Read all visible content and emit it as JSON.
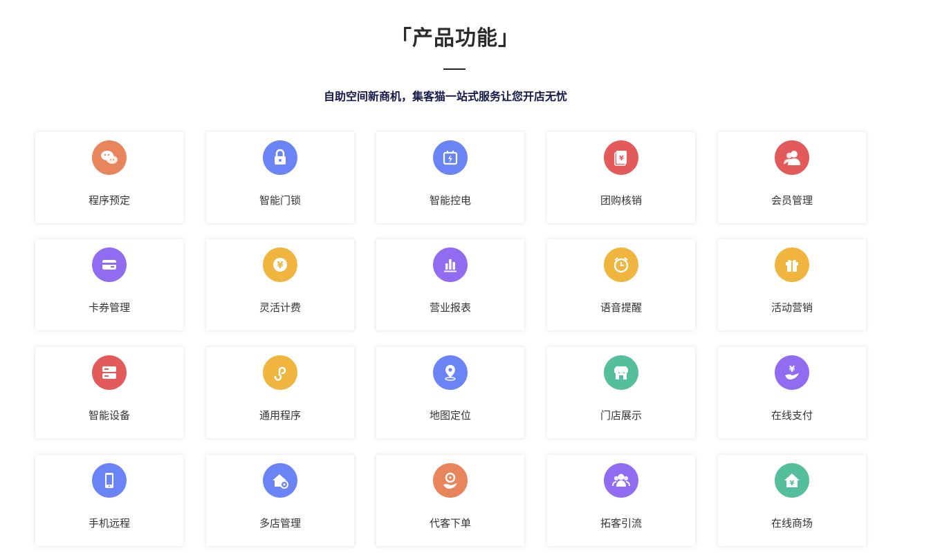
{
  "section": {
    "title": "「产品功能」",
    "subtitle": "自助空间新商机，集客猫一站式服务让您开店无忧"
  },
  "features": [
    {
      "label": "程序预定",
      "icon": "chat-bubbles-icon",
      "color": "#e8855d"
    },
    {
      "label": "智能门锁",
      "icon": "lock-icon",
      "color": "#6b84f5"
    },
    {
      "label": "智能控电",
      "icon": "power-socket-icon",
      "color": "#6b84f5"
    },
    {
      "label": "团购核销",
      "icon": "coupon-book-icon",
      "color": "#e35a5a"
    },
    {
      "label": "会员管理",
      "icon": "members-icon",
      "color": "#e35a5a"
    },
    {
      "label": "卡券管理",
      "icon": "card-icon",
      "color": "#8f6cf0"
    },
    {
      "label": "灵活计费",
      "icon": "yuan-coin-icon",
      "color": "#f0b53f"
    },
    {
      "label": "营业报表",
      "icon": "bar-chart-icon",
      "color": "#8f6cf0"
    },
    {
      "label": "语音提醒",
      "icon": "alarm-clock-icon",
      "color": "#f0b53f"
    },
    {
      "label": "活动营销",
      "icon": "gift-icon",
      "color": "#f0b53f"
    },
    {
      "label": "智能设备",
      "icon": "server-icon",
      "color": "#e35a5a"
    },
    {
      "label": "通用程序",
      "icon": "mini-program-icon",
      "color": "#f0b53f"
    },
    {
      "label": "地图定位",
      "icon": "map-pin-icon",
      "color": "#6b84f5"
    },
    {
      "label": "门店展示",
      "icon": "storefront-icon",
      "color": "#55bf9d"
    },
    {
      "label": "在线支付",
      "icon": "hand-yuan-icon",
      "color": "#8f6cf0"
    },
    {
      "label": "手机远程",
      "icon": "phone-icon",
      "color": "#6b84f5"
    },
    {
      "label": "多店管理",
      "icon": "house-gear-icon",
      "color": "#6b84f5"
    },
    {
      "label": "代客下单",
      "icon": "order-hand-icon",
      "color": "#e8855d"
    },
    {
      "label": "拓客引流",
      "icon": "people-group-icon",
      "color": "#8f6cf0"
    },
    {
      "label": "在线商场",
      "icon": "house-yuan-icon",
      "color": "#55bf9d"
    }
  ]
}
